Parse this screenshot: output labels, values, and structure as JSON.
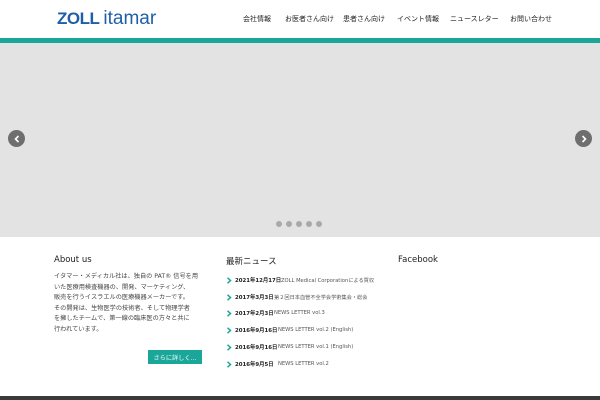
{
  "header": {
    "logo_zoll": "ZOLL",
    "logo_itamar": "itamar",
    "nav": [
      {
        "label": "会社情報"
      },
      {
        "label": "お医者さん向け"
      },
      {
        "label": "患者さん向け"
      },
      {
        "label": "イベント情報"
      },
      {
        "label": "ニュースレター"
      },
      {
        "label": "お問い合わせ"
      }
    ]
  },
  "slider": {
    "prev_icon": "chevron-left-icon",
    "next_icon": "chevron-right-icon",
    "dot_count": 5
  },
  "about": {
    "title": "About us",
    "lines": [
      "イタマー・メディカル社は、独自の PAT® 信号を用",
      "いた医療用検査機器の、開発、マーケティング、",
      "販売を行うイスラエルの医療機器メーカーです。",
      "その開発は、生物医学の技術者、そして物理学者",
      "を擁したチームで、第一線の臨床医の方々と共に",
      "行われています。"
    ],
    "more_button": "さらに詳しく..."
  },
  "news": {
    "title": "最新ニュース",
    "items": [
      {
        "date": "2021年12月17日",
        "title": "ZOLL Medical Corporationによる買収"
      },
      {
        "date": "2017年3月3日",
        "title": "第２回日本血管不全学会学術集会・総会"
      },
      {
        "date": "2017年2月3日",
        "title": "NEWS LETTER vol.3"
      },
      {
        "date": "2016年9月16日",
        "title": "NEWS LETTER vol.2 (English)"
      },
      {
        "date": "2016年9月16日",
        "title": "NEWS LETTER vol.1 (English)"
      },
      {
        "date": "2016年9月5日",
        "title": "NEWS LETTER vol.2"
      }
    ]
  },
  "facebook": {
    "title": "Facebook"
  },
  "colors": {
    "brand_blue": "#1e5fa8",
    "teal": "#1aa79a",
    "slider_bg": "#e3e3e3"
  }
}
